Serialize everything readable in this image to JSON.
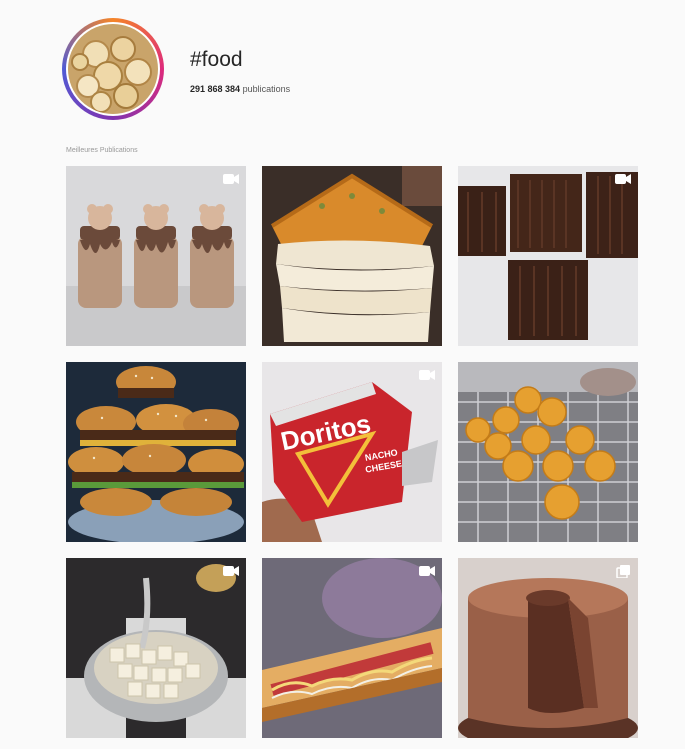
{
  "header": {
    "title": "#food",
    "count": "291 868 384",
    "count_suffix": " publications"
  },
  "section": {
    "label": "Meilleures Publications"
  },
  "posts": [
    {
      "subject": "milkshake-jars",
      "badge": "video-icon"
    },
    {
      "subject": "layered-pastry",
      "badge": "none"
    },
    {
      "subject": "chocolate-cubes",
      "badge": "video-icon"
    },
    {
      "subject": "burger-pile",
      "badge": "none"
    },
    {
      "subject": "doritos-bag",
      "badge": "video-icon"
    },
    {
      "subject": "fried-puffs",
      "badge": "none"
    },
    {
      "subject": "tofu-bowl",
      "badge": "video-icon"
    },
    {
      "subject": "hotdog-pastry",
      "badge": "video-icon"
    },
    {
      "subject": "chocolate-cake",
      "badge": "carousel-icon"
    }
  ],
  "doritos": {
    "brand": "Doritos",
    "flavor_line1": "NACHO",
    "flavor_line2": "CHEESE"
  },
  "colors": {
    "background": "#fafafa",
    "text": "#262626",
    "muted": "#999999"
  }
}
